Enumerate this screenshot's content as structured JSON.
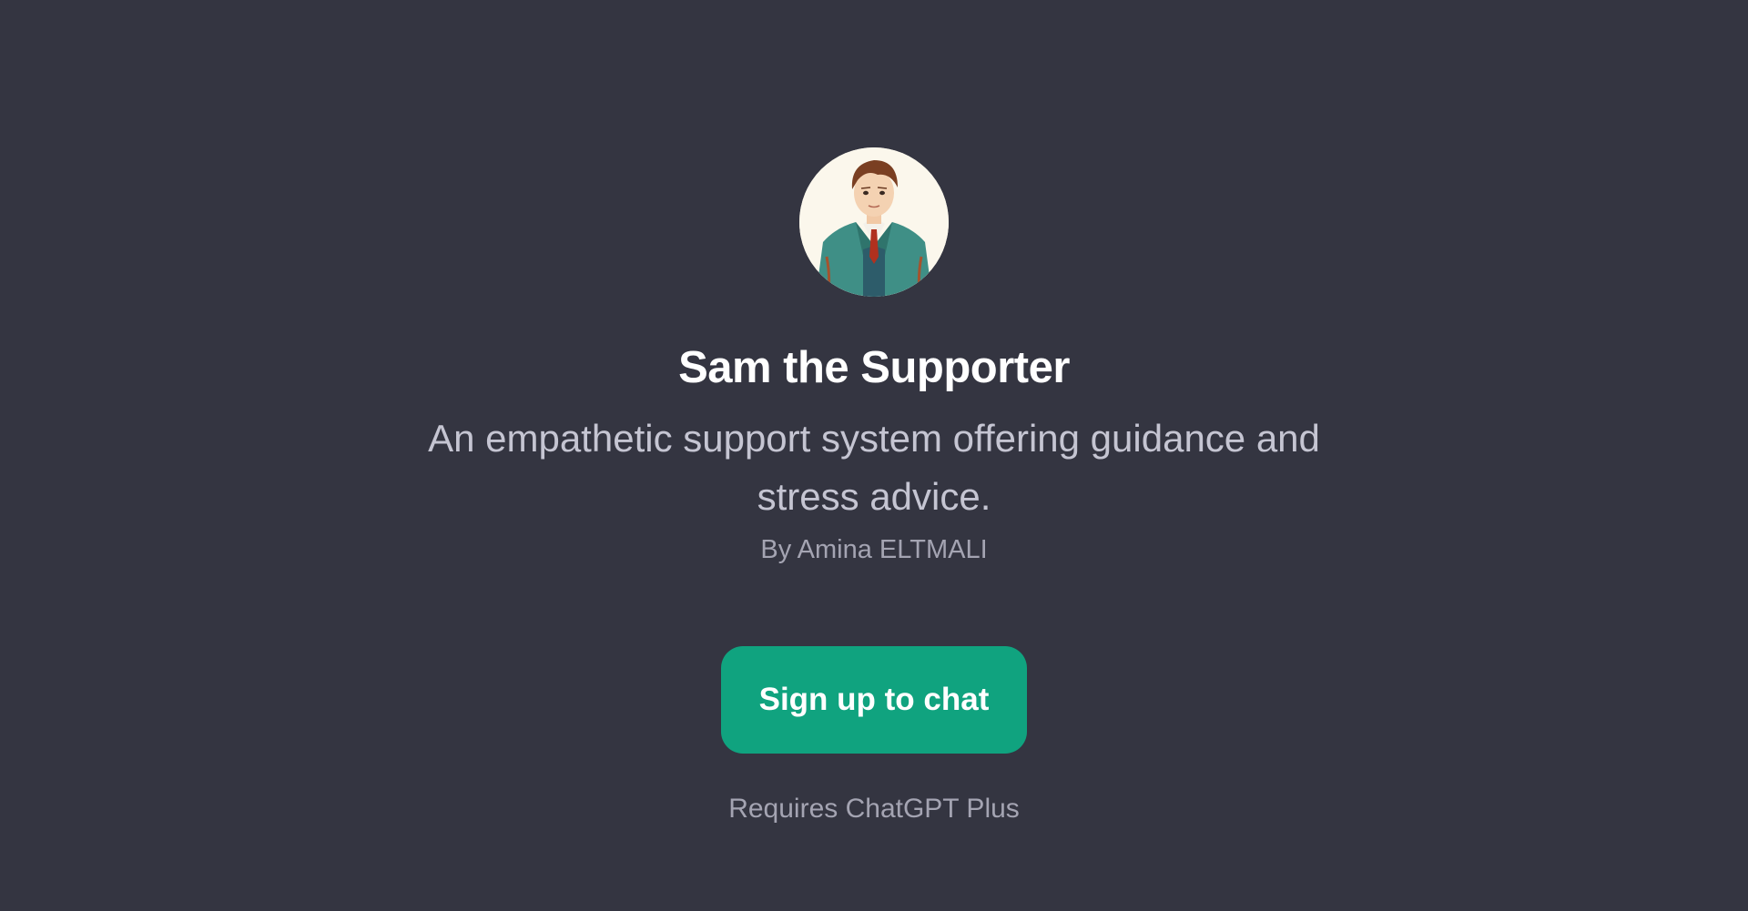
{
  "gpt": {
    "avatar_icon": "person-in-suit-avatar",
    "name": "Sam the Supporter",
    "description": "An empathetic support system offering guidance and stress advice.",
    "author": "By Amina ELTMALI"
  },
  "actions": {
    "signup_label": "Sign up to chat"
  },
  "footer": {
    "requirement_text": "Requires ChatGPT Plus"
  },
  "colors": {
    "background": "#343541",
    "accent": "#10a37f",
    "title": "#ffffff",
    "description": "#c5c5d2",
    "muted": "#a4a4b2"
  }
}
